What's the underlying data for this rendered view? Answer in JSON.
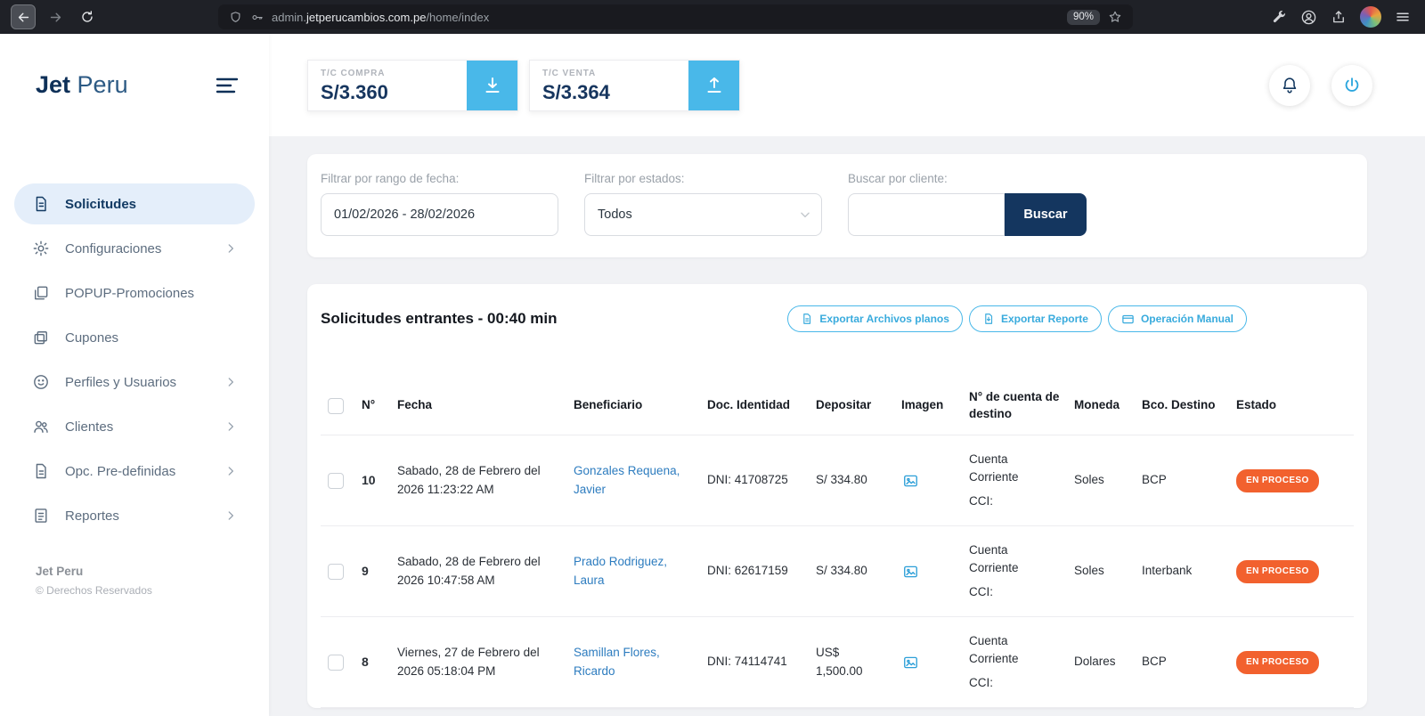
{
  "browser": {
    "url_subdomain": "admin.",
    "url_domain": "jetperucambios.com.pe",
    "url_path": "/home/index",
    "zoom_badge": "90%"
  },
  "sidebar": {
    "logo_primary": "Jet",
    "logo_secondary": "Peru",
    "items": [
      {
        "label": "Solicitudes"
      },
      {
        "label": "Configuraciones"
      },
      {
        "label": "POPUP-Promociones"
      },
      {
        "label": "Cupones"
      },
      {
        "label": "Perfiles y Usuarios"
      },
      {
        "label": "Clientes"
      },
      {
        "label": "Opc. Pre-definidas"
      },
      {
        "label": "Reportes"
      }
    ],
    "footer_brand": "Jet Peru",
    "footer_copyright": "© Derechos Reservados"
  },
  "rates": {
    "compra_label": "T/C COMPRA",
    "compra_value": "S/3.360",
    "venta_label": "T/C VENTA",
    "venta_value": "S/3.364"
  },
  "filters": {
    "date_label": "Filtrar por rango de fecha:",
    "date_value": "01/02/2026 - 28/02/2026",
    "status_label": "Filtrar por estados:",
    "status_value": "Todos",
    "client_label": "Buscar por cliente:",
    "client_value": "",
    "search_button": "Buscar"
  },
  "table": {
    "title": "Solicitudes entrantes - 00:40 min",
    "actions": [
      {
        "label": "Exportar Archivos planos"
      },
      {
        "label": "Exportar Reporte"
      },
      {
        "label": "Operación Manual"
      }
    ],
    "headers": [
      "N°",
      "Fecha",
      "Beneficiario",
      "Doc. Identidad",
      "Depositar",
      "Imagen",
      "N° de cuenta de destino",
      "Moneda",
      "Bco. Destino",
      "Estado"
    ],
    "rows": [
      {
        "num": "10",
        "fecha": "Sabado, 28 de Febrero del 2026 11:23:22 AM",
        "beneficiario": "Gonzales Requena, Javier",
        "doc": "DNI: 41708725",
        "depositar": "S/ 334.80",
        "cuenta_tipo": "Cuenta Corriente",
        "cuenta_cci": "CCI:",
        "moneda": "Soles",
        "banco": "BCP",
        "estado": "EN PROCESO"
      },
      {
        "num": "9",
        "fecha": "Sabado, 28 de Febrero del 2026 10:47:58 AM",
        "beneficiario": "Prado Rodriguez, Laura",
        "doc": "DNI: 62617159",
        "depositar": "S/ 334.80",
        "cuenta_tipo": "Cuenta Corriente",
        "cuenta_cci": "CCI:",
        "moneda": "Soles",
        "banco": "Interbank",
        "estado": "EN PROCESO"
      },
      {
        "num": "8",
        "fecha": "Viernes, 27 de Febrero del 2026 05:18:04 PM",
        "beneficiario": "Samillan Flores, Ricardo",
        "doc": "DNI: 74114741",
        "depositar": "US$ 1,500.00",
        "cuenta_tipo": "Cuenta Corriente",
        "cuenta_cci": "CCI:",
        "moneda": "Dolares",
        "banco": "BCP",
        "estado": "EN PROCESO"
      }
    ]
  },
  "colors": {
    "accent_blue": "#49b8e9",
    "navy": "#14365f",
    "badge_orange": "#f2612e",
    "link_blue": "#2d7cbf"
  }
}
